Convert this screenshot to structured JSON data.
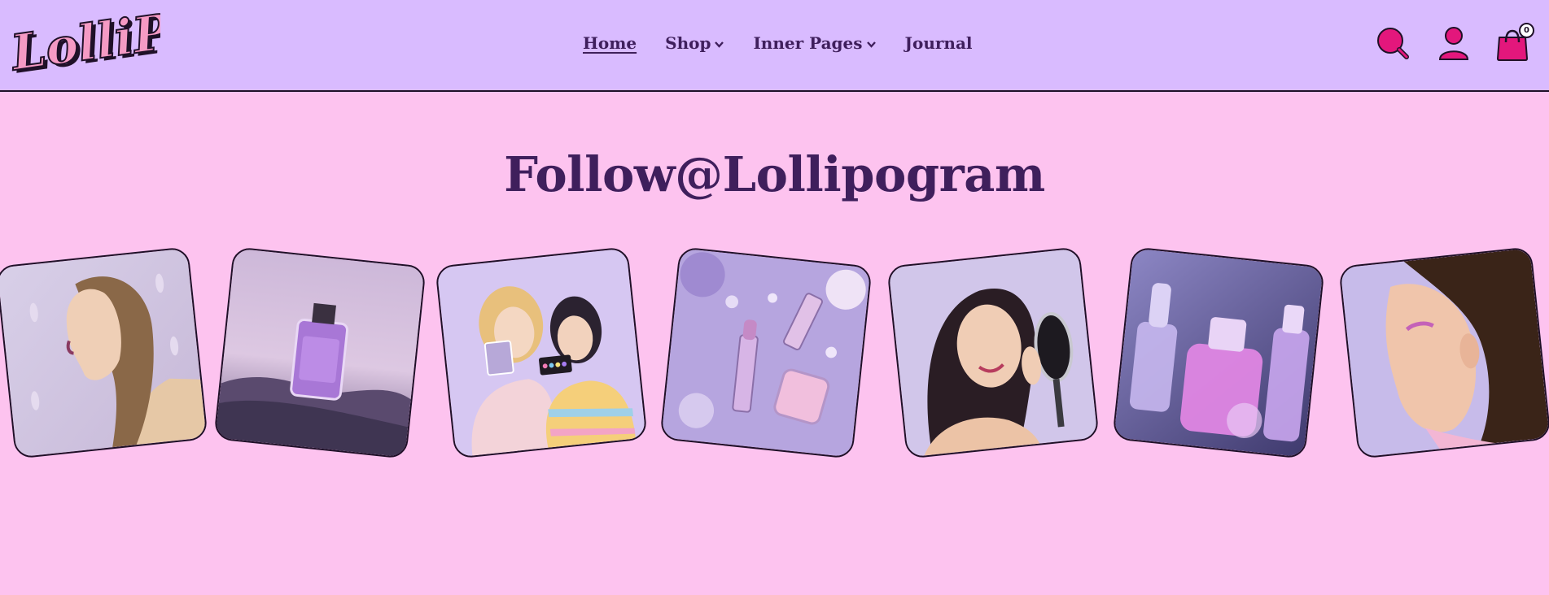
{
  "brand": {
    "logo_text": "LolliPop"
  },
  "nav": {
    "items": [
      {
        "label": "Home",
        "active": true,
        "has_dropdown": false
      },
      {
        "label": "Shop",
        "active": false,
        "has_dropdown": true
      },
      {
        "label": "Inner Pages",
        "active": false,
        "has_dropdown": true
      },
      {
        "label": "Journal",
        "active": false,
        "has_dropdown": false
      }
    ]
  },
  "header_icons": {
    "search_icon": "search-icon",
    "account_icon": "user-icon",
    "cart_icon": "shopping-bag-icon",
    "cart_count": "0"
  },
  "instagram": {
    "title": "Follow@Lollipogram",
    "tiles": [
      {
        "name": "model-profile-lavender-petals"
      },
      {
        "name": "purple-perfume-bottle-on-rocks"
      },
      {
        "name": "two-friends-with-makeup-palettes"
      },
      {
        "name": "lipsticks-and-compacts-flatlay"
      },
      {
        "name": "woman-with-hand-mirror"
      },
      {
        "name": "pink-serum-bottles"
      },
      {
        "name": "woman-side-profile-eyeshadow"
      }
    ]
  },
  "colors": {
    "header_bg": "#d9bbff",
    "page_bg": "#fdc3ef",
    "text": "#3f1f5c",
    "accent": "#e3177c",
    "outline": "#1f1028"
  }
}
